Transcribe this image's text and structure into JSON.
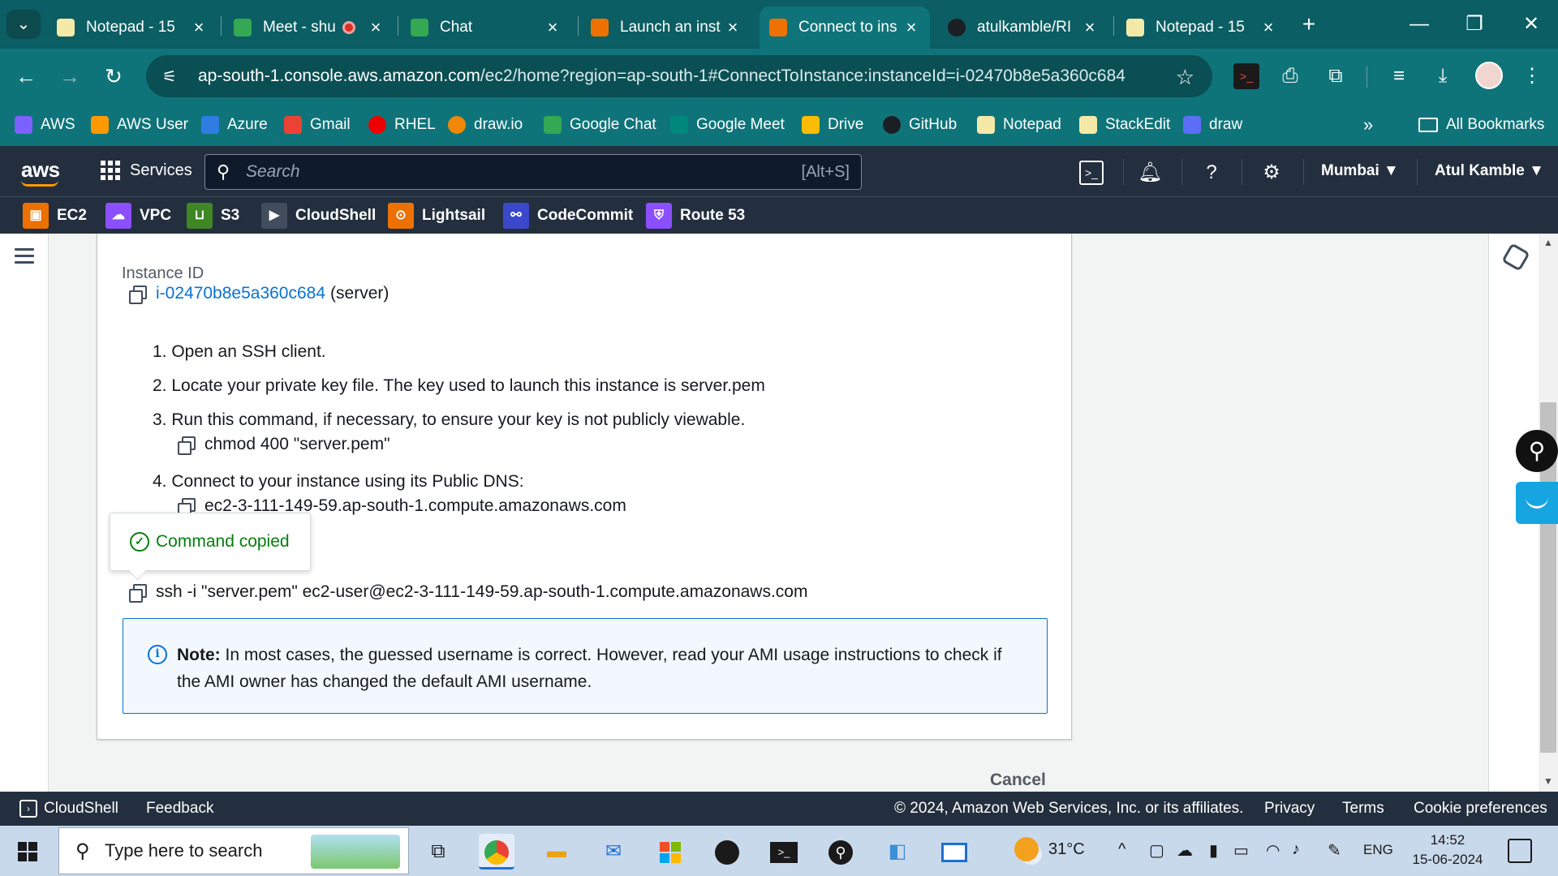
{
  "browser": {
    "tabs": [
      {
        "label": "Notepad - 15",
        "icon": "notepad-icon",
        "color": "#f5e9a8"
      },
      {
        "label": "Meet - shu",
        "icon": "google-meet-icon",
        "color": "#34a853",
        "recording": true
      },
      {
        "label": "Chat",
        "icon": "google-chat-icon",
        "color": "#34a853",
        "closable": true
      },
      {
        "label": "Launch an inst",
        "icon": "aws-ec2-icon",
        "color": "#ed7100"
      },
      {
        "label": "Connect to ins",
        "icon": "aws-ec2-icon",
        "color": "#ed7100",
        "active": true
      },
      {
        "label": "atulkamble/RI",
        "icon": "github-icon",
        "color": "#1b1f23"
      },
      {
        "label": "Notepad - 15",
        "icon": "notepad-icon",
        "color": "#f5e9a8"
      }
    ],
    "new_tab": "+",
    "window_controls": {
      "minimize": "—",
      "restore": "❐",
      "close": "✕"
    },
    "url_host": "ap-south-1.console.aws.amazon.com",
    "url_path": "/ec2/home?region=ap-south-1#ConnectToInstance:instanceId=i-02470b8e5a360c684",
    "bookmarks": [
      {
        "label": "AWS",
        "color": "#7b61ff"
      },
      {
        "label": "AWS User",
        "color": "#ff9900"
      },
      {
        "label": "Azure",
        "color": "#2f7de1"
      },
      {
        "label": "Gmail",
        "color": "#ea4335"
      },
      {
        "label": "RHEL",
        "color": "#ee0000"
      },
      {
        "label": "draw.io",
        "color": "#f08705"
      },
      {
        "label": "Google Chat",
        "color": "#34a853"
      },
      {
        "label": "Google Meet",
        "color": "#00897b"
      },
      {
        "label": "Drive",
        "color": "#fbbc04"
      },
      {
        "label": "GitHub",
        "color": "#1b1f23"
      },
      {
        "label": "Notepad",
        "color": "#f5e9a8"
      },
      {
        "label": "StackEdit",
        "color": "#f5e9a8"
      },
      {
        "label": "draw",
        "color": "#5b6ef5"
      }
    ],
    "more_bookmarks": "»",
    "all_bookmarks": "All Bookmarks"
  },
  "aws_header": {
    "logo": "aws",
    "services": "Services",
    "search_placeholder": "Search",
    "search_shortcut": "[Alt+S]",
    "region": "Mumbai ▼",
    "user": "Atul Kamble ▼",
    "favorites": [
      {
        "label": "EC2",
        "color": "#ed7100"
      },
      {
        "label": "VPC",
        "color": "#8c4fff"
      },
      {
        "label": "S3",
        "color": "#3f8624"
      },
      {
        "label": "CloudShell",
        "color": "#414d5c"
      },
      {
        "label": "Lightsail",
        "color": "#ed7100"
      },
      {
        "label": "CodeCommit",
        "color": "#3b48cc"
      },
      {
        "label": "Route 53",
        "color": "#8c4fff"
      }
    ]
  },
  "connect": {
    "instance_id_label": "Instance ID",
    "instance_id": "i-02470b8e5a360c684",
    "instance_name": "(server)",
    "steps": [
      "1. Open an SSH client.",
      "2. Locate your private key file. The key used to launch this instance is server.pem",
      "3. Run this command, if necessary, to ensure your key is not publicly viewable.",
      "4. Connect to your instance using its Public DNS:"
    ],
    "chmod_cmd": "chmod 400 \"server.pem\"",
    "public_dns": "ec2-3-111-149-59.ap-south-1.compute.amazonaws.com",
    "ssh_cmd": "ssh -i \"server.pem\" ec2-user@ec2-3-111-149-59.ap-south-1.compute.amazonaws.com",
    "tooltip": "Command copied",
    "note_label": "Note:",
    "note_text": " In most cases, the guessed username is correct. However, read your AMI usage instructions to check if the AMI owner has changed the default AMI username.",
    "cancel": "Cancel"
  },
  "aws_footer": {
    "cloudshell": "CloudShell",
    "feedback": "Feedback",
    "copyright": "© 2024, Amazon Web Services, Inc. or its affiliates.",
    "privacy": "Privacy",
    "terms": "Terms",
    "cookies": "Cookie preferences"
  },
  "taskbar": {
    "search_placeholder": "Type here to search",
    "temperature": "31°C",
    "language": "ENG",
    "time": "14:52",
    "date": "15-06-2024"
  }
}
